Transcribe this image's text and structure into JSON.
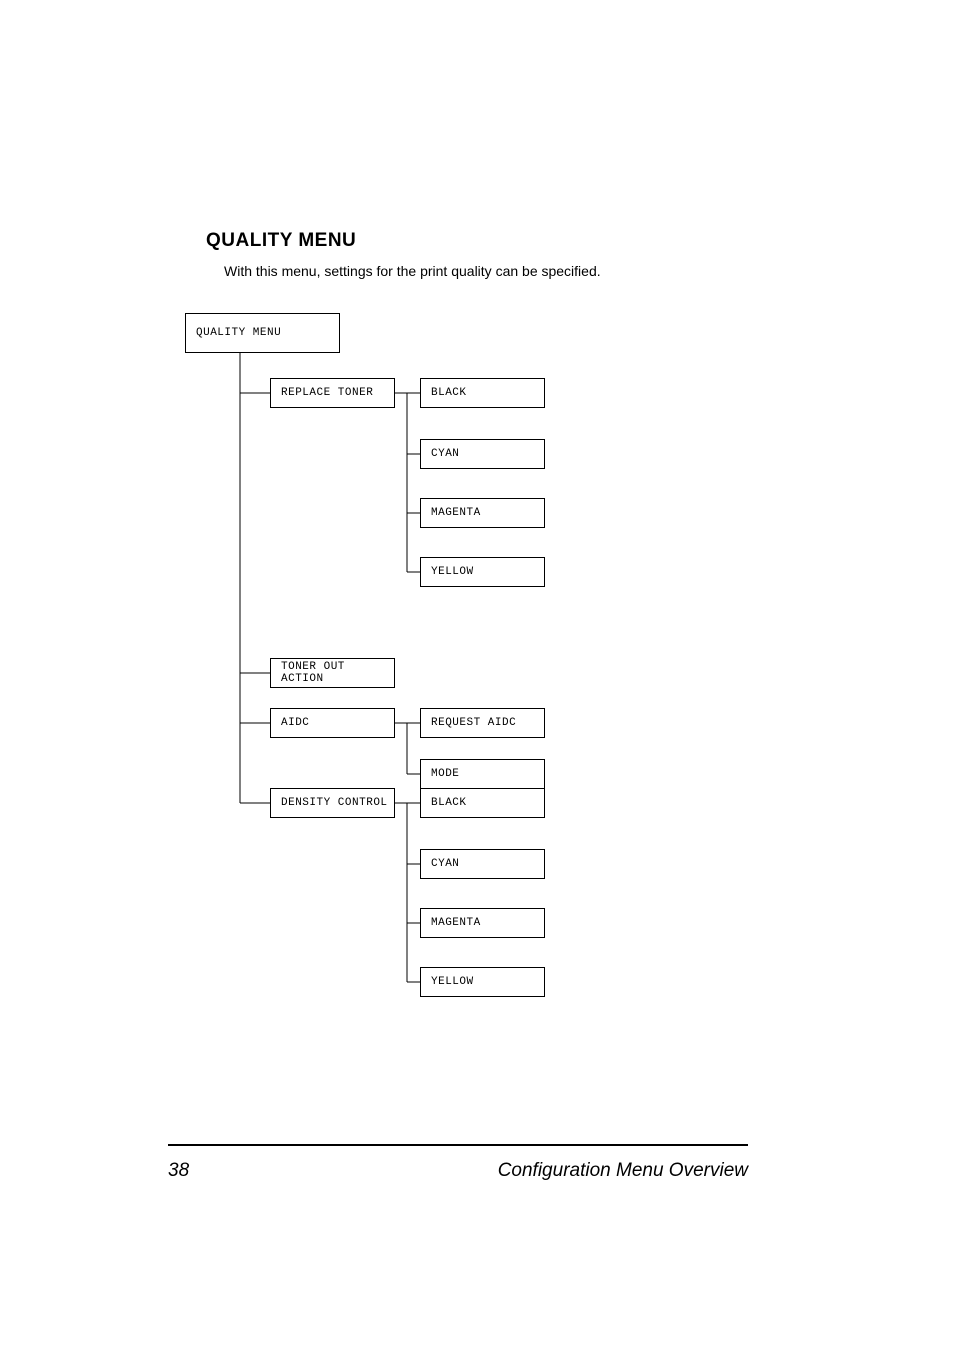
{
  "heading": "QUALITY MENU",
  "subtext": "With this menu, settings for the print quality can be specified.",
  "tree": {
    "root": "QUALITY MENU",
    "replace_toner": "REPLACE TONER",
    "replace_children": {
      "black": "BLACK",
      "cyan": "CYAN",
      "magenta": "MAGENTA",
      "yellow": "YELLOW"
    },
    "toner_out_action": "TONER OUT ACTION",
    "aidc": "AIDC",
    "aidc_children": {
      "request_aidc": "REQUEST AIDC",
      "mode": "MODE"
    },
    "density_control": "DENSITY CONTROL",
    "density_children": {
      "black": "BLACK",
      "cyan": "CYAN",
      "magenta": "MAGENTA",
      "yellow": "YELLOW"
    }
  },
  "footer": {
    "page": "38",
    "title": "Configuration Menu Overview"
  }
}
